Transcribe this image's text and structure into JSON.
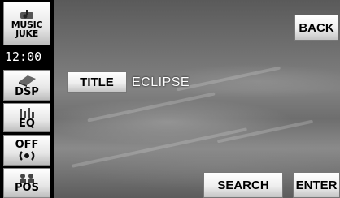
{
  "sidebar": {
    "music_juke": {
      "line1": "MUSIC",
      "line2": "JUKE"
    },
    "clock": "12:00",
    "dsp": "DSP",
    "eq": "EQ",
    "off": "OFF",
    "pos": "POS"
  },
  "header": {
    "back_label": "BACK"
  },
  "main": {
    "title_label": "TITLE",
    "title_value": "ECLIPSE"
  },
  "footer": {
    "search_label": "SEARCH",
    "enter_label": "ENTER"
  },
  "colors": {
    "background": "#000000",
    "button_face": "#eeeeee",
    "text_light": "#ffffff"
  }
}
